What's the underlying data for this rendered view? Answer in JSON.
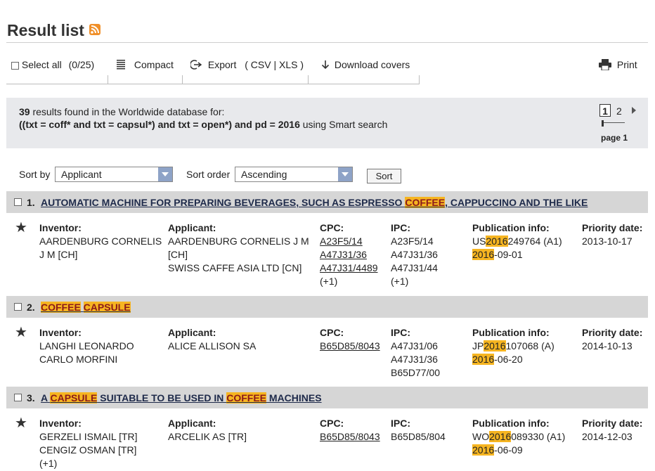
{
  "page": {
    "title": "Result list"
  },
  "toolbar": {
    "select_all": "Select all",
    "count": "(0/25)",
    "compact": "Compact",
    "export": "Export",
    "export_formats": "( CSV | XLS )",
    "download_covers": "Download covers",
    "print": "Print"
  },
  "info": {
    "count": "39",
    "line1_rest": " results found in the Worldwide database for:",
    "query": "((txt = coff* and txt = capsul*) and txt = open*) and pd = 2016",
    "query_suffix": " using Smart search"
  },
  "pagination": {
    "current": "1",
    "next": "2",
    "label": "page 1"
  },
  "sort": {
    "sort_by_label": "Sort by",
    "sort_by_value": "Applicant",
    "order_label": "Sort order",
    "order_value": "Ascending",
    "button": "Sort"
  },
  "labels": {
    "inventor": "Inventor:",
    "applicant": "Applicant:",
    "cpc": "CPC:",
    "ipc": "IPC:",
    "pubinfo": "Publication info:",
    "priority": "Priority date:"
  },
  "results": [
    {
      "num": "1.",
      "title_parts": [
        "AUTOMATIC MACHINE FOR PREPARING BEVERAGES, SUCH AS ESPRESSO ",
        "COFFEE",
        ", CAPPUCCINO AND THE LIKE"
      ],
      "inventors": [
        "AARDENBURG CORNELIS",
        "J M  [CH]"
      ],
      "applicants": [
        "AARDENBURG CORNELIS J M",
        "[CH]",
        "SWISS CAFFE ASIA LTD  [CN]"
      ],
      "cpc": [
        "A23F5/14",
        "A47J31/36",
        "A47J31/4489",
        "(+1)"
      ],
      "ipc": [
        "A23F5/14",
        "A47J31/36",
        "A47J31/44",
        "(+1)"
      ],
      "pub_prefix": "US",
      "pub_year": "2016",
      "pub_rest": "249764 (A1)",
      "pub_date_rest": "-09-01",
      "priority": "2013-10-17"
    },
    {
      "num": "2.",
      "title_parts": [
        "COFFEE",
        "CAPSULE"
      ],
      "inventors": [
        "LANGHI LEONARDO",
        "CARLO MORFINI"
      ],
      "applicants": [
        "ALICE ALLISON SA"
      ],
      "cpc": [
        "B65D85/8043"
      ],
      "ipc": [
        "A47J31/06",
        "A47J31/36",
        "B65D77/00"
      ],
      "pub_prefix": "JP",
      "pub_year": "2016",
      "pub_rest": "107068 (A)",
      "pub_date_rest": "-06-20",
      "priority": "2014-10-13"
    },
    {
      "num": "3.",
      "title_parts": [
        "A ",
        "CAPSULE",
        " SUITABLE TO BE USED IN ",
        "COFFEE",
        " MACHINES"
      ],
      "inventors": [
        "GERZELI ISMAIL  [TR]",
        "CENGIZ OSMAN  [TR]",
        "(+1)"
      ],
      "applicants": [
        "ARCELIK AS  [TR]"
      ],
      "cpc": [
        "B65D85/8043"
      ],
      "ipc": [
        "B65D85/804"
      ],
      "pub_prefix": "WO",
      "pub_year": "2016",
      "pub_rest": "089330 (A1)",
      "pub_date_rest": "-06-09",
      "priority": "2014-12-03"
    }
  ]
}
